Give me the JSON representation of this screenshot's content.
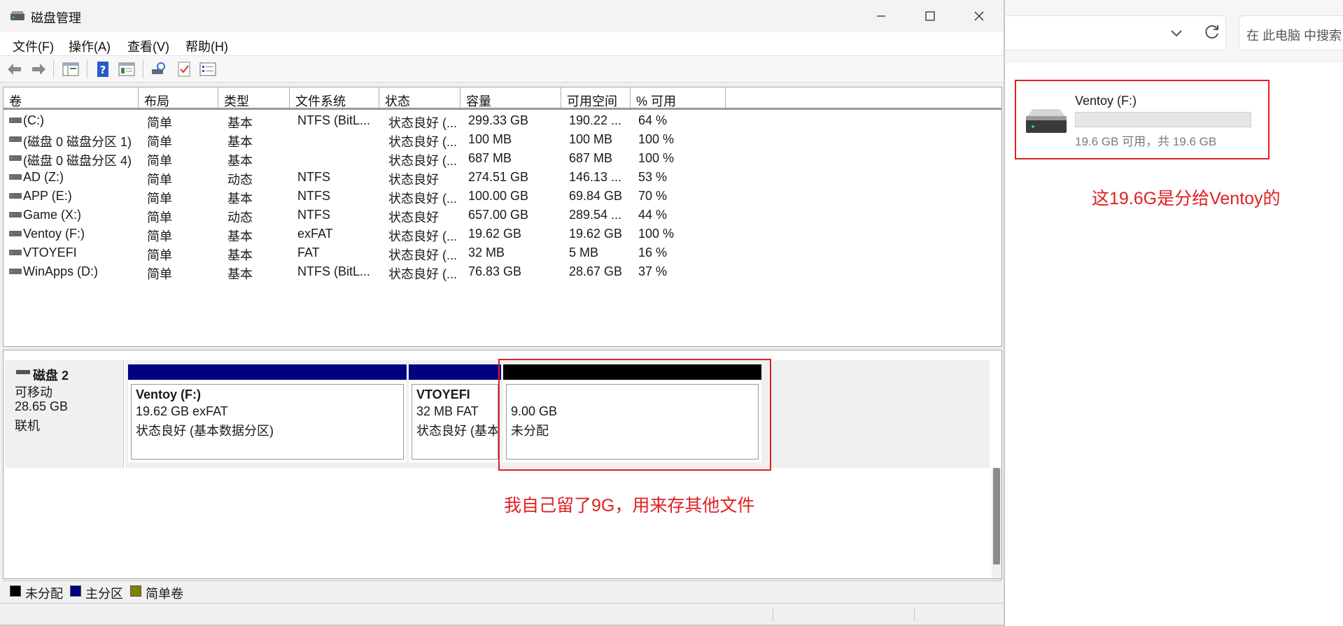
{
  "explorer": {
    "search_placeholder": "在 此电脑 中搜索",
    "drive": {
      "name": "Ventoy (F:)",
      "free_fraction": 1.0,
      "size_text": "19.6 GB 可用，共 19.6 GB"
    },
    "note": "这19.6G是分给Ventoy的"
  },
  "window": {
    "title": "磁盘管理",
    "menu": [
      "文件(F)",
      "操作(A)",
      "查看(V)",
      "帮助(H)"
    ],
    "toolbar_icons": [
      "back-icon",
      "forward-icon",
      "console-tree-icon",
      "help-icon",
      "properties-icon",
      "rescan-icon",
      "check-icon",
      "settings-list-icon"
    ]
  },
  "volume_list": {
    "columns": [
      "卷",
      "布局",
      "类型",
      "文件系统",
      "状态",
      "容量",
      "可用空间",
      "% 可用"
    ],
    "rows": [
      [
        "(C:)",
        "简单",
        "基本",
        "NTFS (BitL...",
        "状态良好 (...",
        "299.33 GB",
        "190.22 ...",
        "64 %"
      ],
      [
        "(磁盘 0 磁盘分区 1)",
        "简单",
        "基本",
        "",
        "状态良好 (...",
        "100 MB",
        "100 MB",
        "100 %"
      ],
      [
        "(磁盘 0 磁盘分区 4)",
        "简单",
        "基本",
        "",
        "状态良好 (...",
        "687 MB",
        "687 MB",
        "100 %"
      ],
      [
        "AD (Z:)",
        "简单",
        "动态",
        "NTFS",
        "状态良好",
        "274.51 GB",
        "146.13 ...",
        "53 %"
      ],
      [
        "APP (E:)",
        "简单",
        "基本",
        "NTFS",
        "状态良好 (...",
        "100.00 GB",
        "69.84 GB",
        "70 %"
      ],
      [
        "Game (X:)",
        "简单",
        "动态",
        "NTFS",
        "状态良好",
        "657.00 GB",
        "289.54 ...",
        "44 %"
      ],
      [
        "Ventoy (F:)",
        "简单",
        "基本",
        "exFAT",
        "状态良好 (...",
        "19.62 GB",
        "19.62 GB",
        "100 %"
      ],
      [
        "VTOYEFI",
        "简单",
        "基本",
        "FAT",
        "状态良好 (...",
        "32 MB",
        "5 MB",
        "16 %"
      ],
      [
        "WinApps (D:)",
        "简单",
        "基本",
        "NTFS (BitL...",
        "状态良好 (...",
        "76.83 GB",
        "28.67 GB",
        "37 %"
      ]
    ]
  },
  "disk": {
    "title": "磁盘 2",
    "type": "可移动",
    "size": "28.65 GB",
    "status": "联机",
    "partitions": [
      {
        "name": "Ventoy  (F:)",
        "size": "19.62 GB exFAT",
        "status": "状态良好 (基本数据分区)",
        "color": "#000080"
      },
      {
        "name": "VTOYEFI",
        "size": "32 MB FAT",
        "status": "状态良好 (基本",
        "color": "#000080"
      },
      {
        "name": "",
        "size": "9.00 GB",
        "status": "未分配",
        "color": "#000000"
      }
    ],
    "note": "我自己留了9G，用来存其他文件"
  },
  "legend": [
    {
      "label": "未分配",
      "color": "#000000"
    },
    {
      "label": "主分区",
      "color": "#000080"
    },
    {
      "label": "简单卷",
      "color": "#808000"
    }
  ],
  "colors": {
    "annotation": "#e02020",
    "primary_partition": "#000080",
    "unallocated": "#000000"
  }
}
